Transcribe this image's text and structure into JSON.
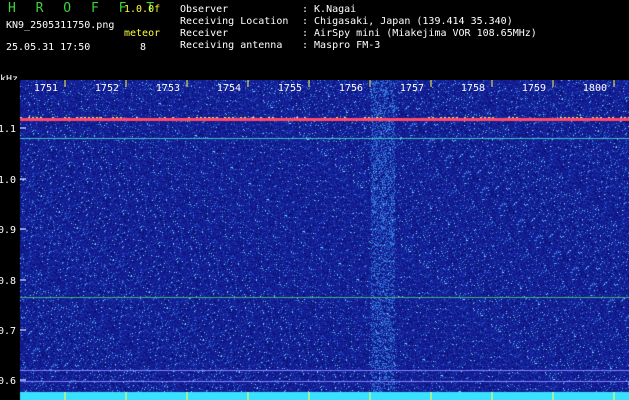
{
  "header": {
    "app_title": "H R O F F T",
    "version": "1.0.0f",
    "filename": "KN9_2505311750.png",
    "meteor_label": "meteor",
    "datetime": "25.05.31 17:50",
    "meteor_count": "8"
  },
  "metadata": [
    {
      "key": "Observer",
      "value": ": K.Nagai"
    },
    {
      "key": "Receiving Location",
      "value": ": Chigasaki, Japan (139.414 35.340)"
    },
    {
      "key": "Receiver",
      "value": ": AirSpy mini (Miakejima VOR 108.65MHz)"
    },
    {
      "key": "Receiving antenna",
      "value": ": Maspro FM-3"
    }
  ],
  "axis": {
    "unit": "kHz",
    "x_ticks": [
      "1751",
      "1752",
      "1753",
      "1754",
      "1755",
      "1756",
      "1757",
      "1758",
      "1759",
      "1800"
    ],
    "y_ticks": [
      "1.1",
      "1.0",
      "0.9",
      "0.8",
      "0.7",
      "0.6"
    ]
  },
  "colors": {
    "background": "#1a2a9c",
    "text_green": "#3cd23c",
    "text_white": "#ffffff",
    "text_yellow": "#ffff3c",
    "carrier_line": "#ff4a6a",
    "tick_yellow": "#ffff3c"
  }
}
